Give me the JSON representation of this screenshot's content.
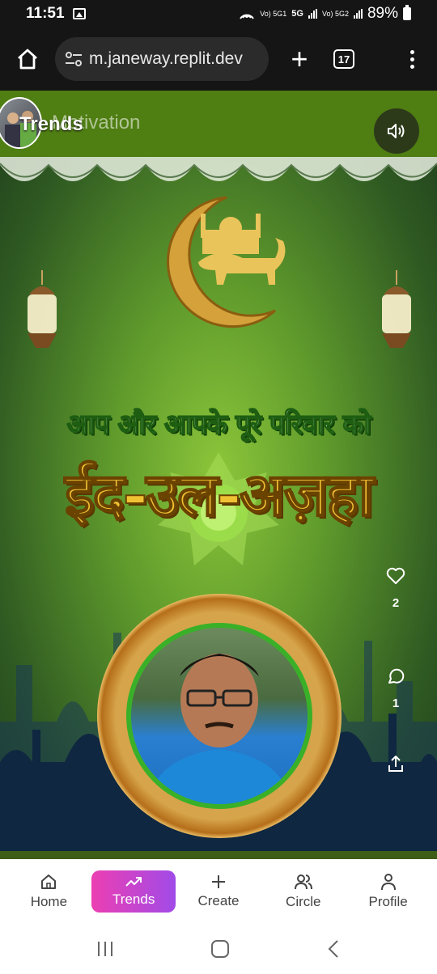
{
  "status_bar": {
    "time": "11:51",
    "sim1_label": "Vo) 5G1",
    "network_label": "5G",
    "sim2_label": "Vo) 5G2",
    "battery": "89%"
  },
  "browser": {
    "url": "m.janeway.replit.dev",
    "tab_count": "17"
  },
  "feed": {
    "page_tag": "Trends",
    "category": "Motivation",
    "greeting_text": "आप और आपके पूरे परिवार को",
    "festival_text": "ईद-उल-अज़हा",
    "likes": "2",
    "comments": "1"
  },
  "bottom_nav": {
    "items": [
      {
        "label": "Home",
        "icon": "home-icon"
      },
      {
        "label": "Trends",
        "icon": "trending-icon"
      },
      {
        "label": "Create",
        "icon": "plus-icon"
      },
      {
        "label": "Circle",
        "icon": "people-icon"
      },
      {
        "label": "Profile",
        "icon": "user-icon"
      }
    ],
    "active": "Trends",
    "active_gradient": [
      "#ec3fb2",
      "#a14be8"
    ]
  },
  "colors": {
    "top_band": "#4f7e12",
    "festival_gold": "#f0c233",
    "medallion_ring": "#3ab029"
  }
}
